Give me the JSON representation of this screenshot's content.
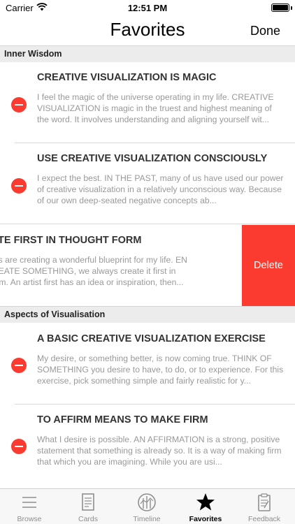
{
  "status_bar": {
    "carrier": "Carrier",
    "time": "12:51 PM"
  },
  "nav": {
    "title": "Favorites",
    "done_label": "Done"
  },
  "sections": [
    {
      "header": "Inner Wisdom"
    },
    {
      "header": "Aspects of Visualisation"
    }
  ],
  "rows": [
    {
      "title": "CREATIVE VISUALIZATION IS MAGIC",
      "body": "I feel the magic of the universe operating in my life. CREATIVE VISUALIZATION is magic in the truest and highest meaning of the word. It involves understanding and aligning yourself wit..."
    },
    {
      "title": "USE CREATIVE VISUALIZATION CONSCIOUSLY",
      "body": "I expect the best. IN THE PAST, many of us have used our power of creative visualization in a relatively unconscious way. Because of our own deep-seated negative concepts ab..."
    },
    {
      "title": "CREATE FIRST IN THOUGHT FORM",
      "body": "thoughts are creating a wonderful blueprint for my life. EN WE CREATE SOMETHING, we always create it first in ught form. An artist first has an idea or inspiration, then...",
      "delete_label": "Delete"
    },
    {
      "title": "A BASIC CREATIVE VISUALIZATION EXERCISE",
      "body": "My desire, or something better, is now coming true. THINK OF SOMETHING you desire to have, to do, or to experience. For this exercise, pick something simple and fairly realistic for y..."
    },
    {
      "title": "TO AFFIRM MEANS TO MAKE FIRM",
      "body": "What I desire is possible. AN AFFIRMATION is a strong, positive statement that something is already so. It is a way of making firm that which you are imagining. While you are usi..."
    }
  ],
  "tabs": [
    {
      "label": "Browse",
      "icon": "list-icon"
    },
    {
      "label": "Cards",
      "icon": "card-icon"
    },
    {
      "label": "Timeline",
      "icon": "timeline-icon"
    },
    {
      "label": "Favorites",
      "icon": "star-icon",
      "active": true
    },
    {
      "label": "Feedback",
      "icon": "clipboard-icon"
    }
  ],
  "colors": {
    "accent_red": "#fb3a30",
    "tab_inactive": "#8e8e8e",
    "section_bg": "#ececec"
  }
}
